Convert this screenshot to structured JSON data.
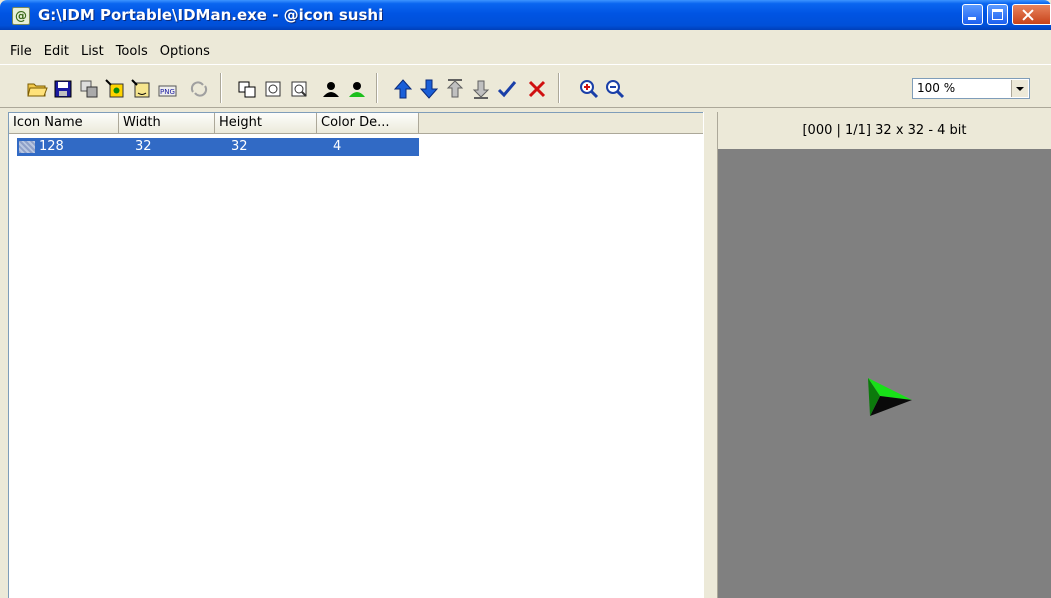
{
  "window": {
    "title": "G:\\IDM Portable\\IDMan.exe - @icon sushi",
    "app_icon": "@"
  },
  "menu": [
    "File",
    "Edit",
    "List",
    "Tools",
    "Options"
  ],
  "toolbar": {
    "zoom_value": "100 %"
  },
  "list": {
    "columns": [
      "Icon Name",
      "Width",
      "Height",
      "Color De..."
    ],
    "rows": [
      {
        "name": "128",
        "width": "32",
        "height": "32",
        "color_depth": "4",
        "selected": true
      }
    ]
  },
  "preview": {
    "info": "[000 | 1/1] 32 x 32 - 4 bit",
    "background": "#808080",
    "icon_color": "#18e018"
  }
}
